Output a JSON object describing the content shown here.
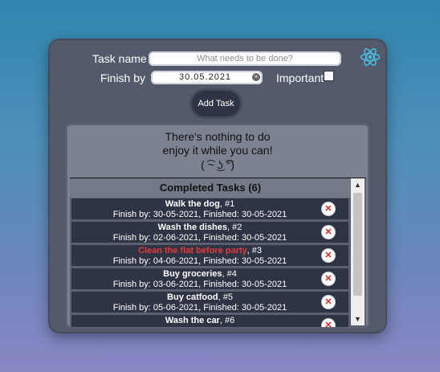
{
  "form": {
    "task_label": "Task name",
    "task_placeholder": "What needs to be done?",
    "finish_label": "Finish by",
    "finish_value": "30.05.2021",
    "important_label": "Important",
    "important_checked": false,
    "add_button": "Add Task"
  },
  "todo": {
    "empty_line1": "There's nothing to do",
    "empty_line2": "enjoy it while you can!",
    "face": "( ͡~ ͜ʖ ͡°)"
  },
  "completed": {
    "header": "Completed Tasks (6)",
    "tasks": [
      {
        "name": "Walk the dog",
        "num": ", #1",
        "dates": "Finish by: 30-05-2021, Finished: 30-05-2021",
        "important": false
      },
      {
        "name": "Wash the dishes",
        "num": ", #2",
        "dates": "Finish by: 02-06-2021, Finished: 30-05-2021",
        "important": false
      },
      {
        "name": "Clean the flat before party",
        "num": ", #3",
        "dates": "Finish by: 04-06-2021, Finished: 30-05-2021",
        "important": true
      },
      {
        "name": "Buy groceries",
        "num": ", #4",
        "dates": "Finish by: 03-06-2021, Finished: 30-05-2021",
        "important": false
      },
      {
        "name": "Buy catfood",
        "num": ", #5",
        "dates": "Finish by: 05-06-2021, Finished: 30-05-2021",
        "important": false
      },
      {
        "name": "Wash the car",
        "num": ", #6",
        "dates": "",
        "important": false
      }
    ]
  },
  "icons": {
    "app": "react-logo-icon",
    "delete": "delete-x-icon",
    "clear": "clear-date-icon"
  },
  "colors": {
    "important": "#e23a3a",
    "row_bg": "#2f3445",
    "card_bg": "#535a6b"
  }
}
